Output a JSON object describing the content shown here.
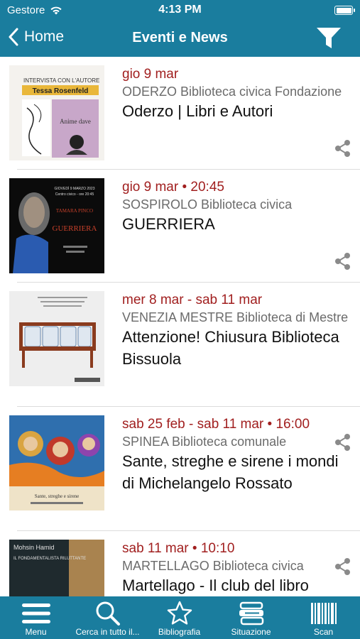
{
  "status_bar": {
    "carrier": "Gestore",
    "time": "4:13 PM"
  },
  "nav": {
    "back_label": "Home",
    "title": "Eventi e News"
  },
  "thumbnails": {
    "item1": {
      "lines": [
        "INTERVISTA CON L'AUTORE",
        "Tessa Rosenfeld",
        "Anime dave"
      ]
    },
    "item2": {
      "lines": [
        "GIOVEDÌ 9 MARZO 2023",
        "Centro civico - ore 20:45",
        "TAMARA PINCO",
        "GUERRIERA"
      ]
    },
    "item4": {
      "lines": [
        "Sante, streghe e sirene"
      ]
    },
    "item5": {
      "lines": [
        "Mohsin Hamid",
        "IL FONDAMENTALISTA RILUTTANTE"
      ]
    }
  },
  "events": [
    {
      "date": "gio 9 mar",
      "place": "ODERZO Biblioteca civica Fondazione",
      "title": "Oderzo | Libri e Autori"
    },
    {
      "date": "gio 9 mar • 20:45",
      "place": "SOSPIROLO Biblioteca civica",
      "title": "GUERRIERA"
    },
    {
      "date": "mer 8 mar - sab 11 mar",
      "place": "VENEZIA MESTRE Biblioteca di Mestre",
      "title": "Attenzione! Chiusura Biblioteca Bissuola"
    },
    {
      "date": "sab 25 feb - sab 11 mar • 16:00",
      "place": "SPINEA Biblioteca comunale",
      "title": "Sante, streghe e sirene i mondi di Michelangelo Rossato"
    },
    {
      "date": "sab 11 mar • 10:10",
      "place": "MARTELLAGO Biblioteca civica",
      "title": "Martellago - Il club del libro"
    }
  ],
  "tabs": [
    {
      "label": "Menu",
      "icon": "menu-icon"
    },
    {
      "label": "Cerca in tutto il...",
      "icon": "search-icon"
    },
    {
      "label": "Bibliografia",
      "icon": "star-icon"
    },
    {
      "label": "Situazione",
      "icon": "books-icon"
    },
    {
      "label": "Scan",
      "icon": "barcode-icon"
    }
  ],
  "colors": {
    "primary": "#1a7d9e",
    "date_red": "#a11f1f",
    "place_gray": "#6b6b6b"
  }
}
